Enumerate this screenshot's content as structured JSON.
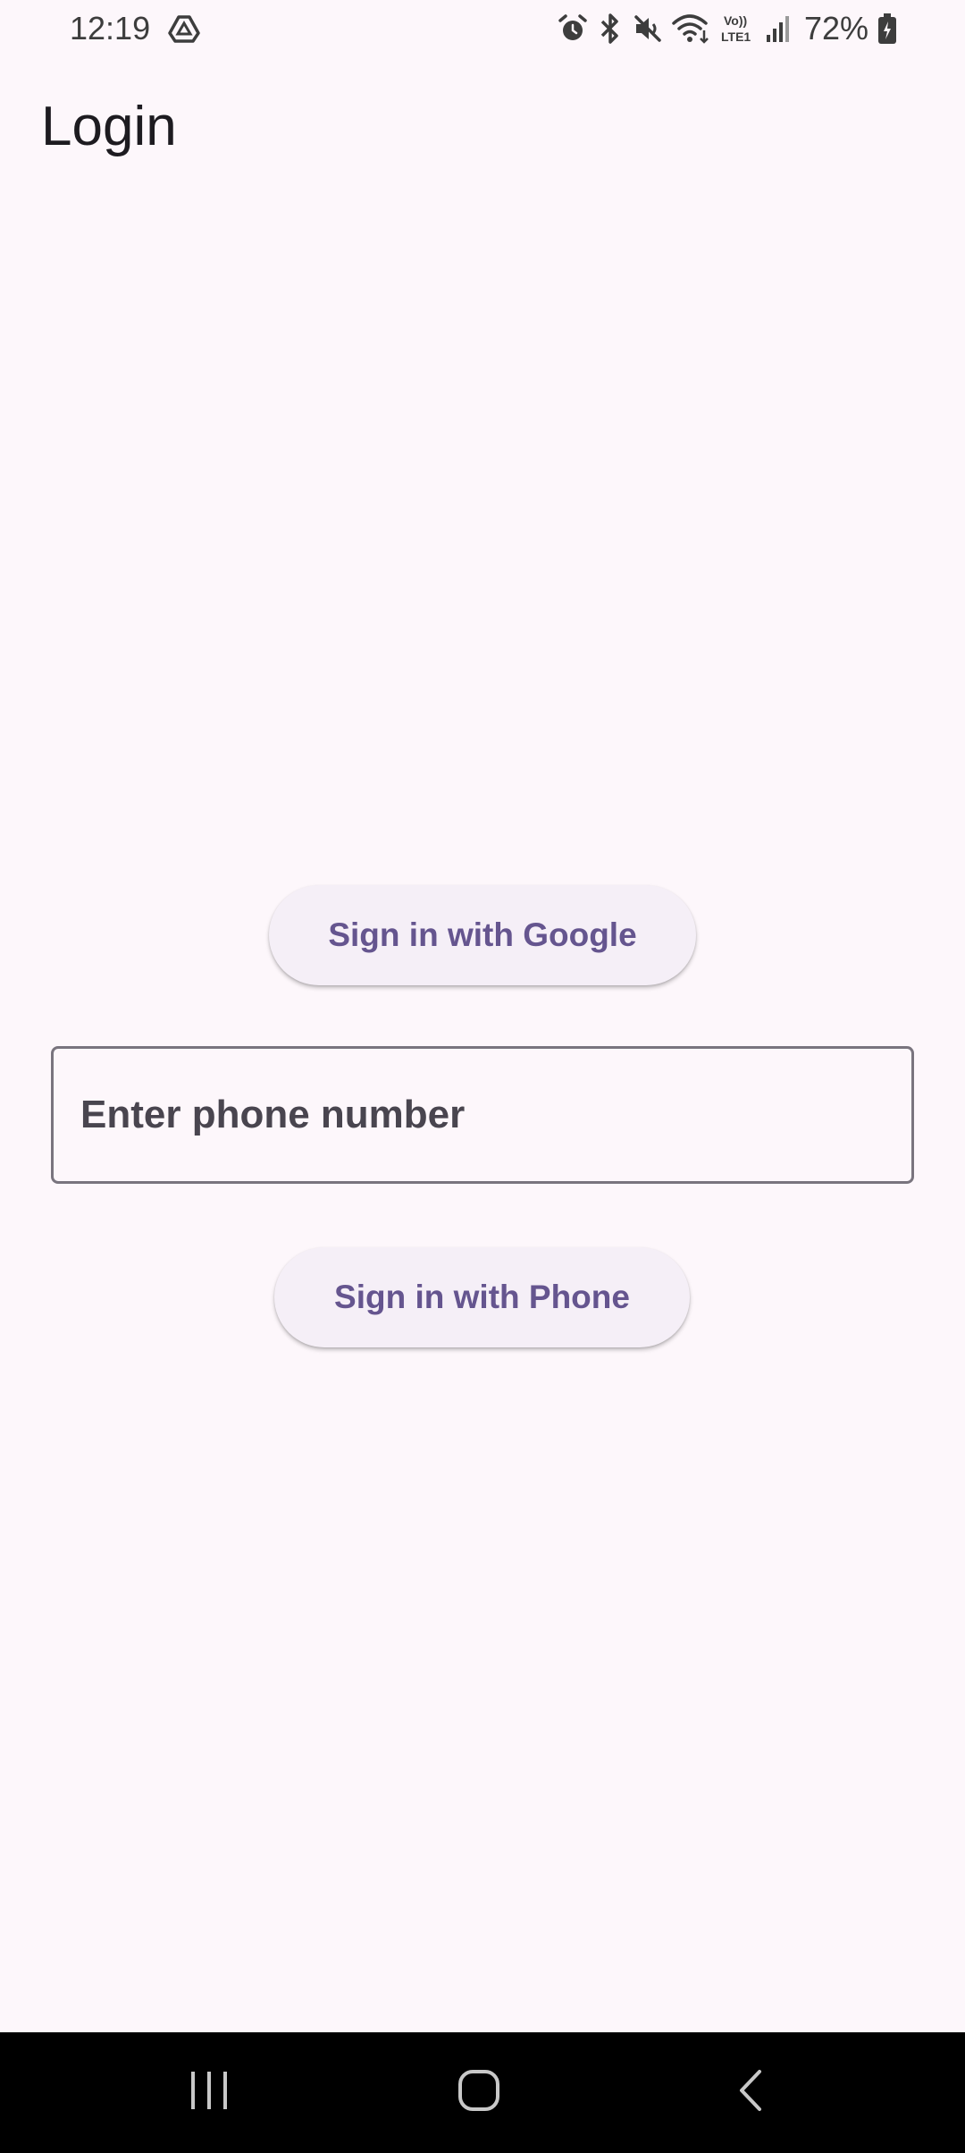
{
  "status_bar": {
    "time": "12:19",
    "battery_percent": "72%",
    "icons": [
      "drive-icon",
      "alarm-icon",
      "bluetooth-icon",
      "mute-icon",
      "wifi-icon",
      "volte-icon",
      "signal-icon",
      "battery-icon"
    ]
  },
  "app_bar": {
    "title": "Login"
  },
  "login": {
    "google_button_label": "Sign in with Google",
    "phone_placeholder": "Enter phone number",
    "phone_value": "",
    "phone_button_label": "Sign in with Phone"
  },
  "colors": {
    "background": "#fdf7fb",
    "button_background": "#f5eff7",
    "button_text": "#65558f",
    "field_border": "#79747e",
    "nav_bar": "#000000"
  },
  "nav_bar": {
    "buttons": [
      "recents-icon",
      "home-icon",
      "back-icon"
    ]
  }
}
